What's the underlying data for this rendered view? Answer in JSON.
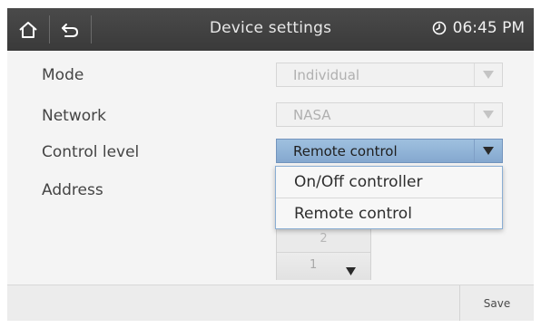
{
  "header": {
    "title": "Device settings",
    "time": "06:45 PM",
    "home_icon": "home-icon",
    "back_icon": "back-arrow-icon",
    "clock_icon": "clock-icon"
  },
  "form": {
    "mode": {
      "label": "Mode",
      "value": "Individual",
      "enabled": false
    },
    "network": {
      "label": "Network",
      "value": "NASA",
      "enabled": false
    },
    "control_level": {
      "label": "Control level",
      "value": "Remote control",
      "open": true
    },
    "address": {
      "label": "Address",
      "upper_value": "2",
      "value": "1"
    }
  },
  "dropdown": {
    "options": [
      "On/Off controller",
      "Remote control"
    ]
  },
  "footer": {
    "save_label": "Save"
  },
  "colors": {
    "header_bg": "#3f3f3f",
    "active_select": "#8fb1d6",
    "popup_border": "#8aaed3"
  }
}
